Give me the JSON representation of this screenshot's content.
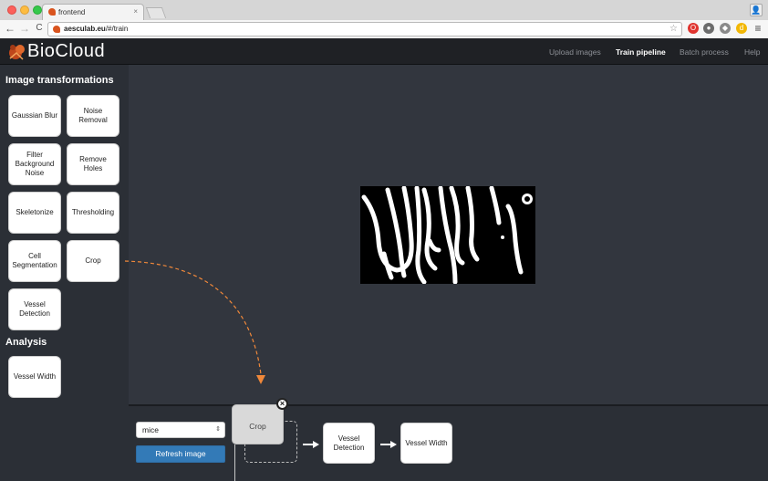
{
  "browser": {
    "tab_title": "frontend",
    "tab_close": "×",
    "url_domain": "aesculab.eu",
    "url_path": "/#/train",
    "back_glyph": "←",
    "forward_glyph": "→",
    "reload_glyph": "C",
    "star_glyph": "☆",
    "menu_glyph": "≡",
    "profile_glyph": "👤",
    "extension_icons": [
      "opera-icon",
      "ghostery-icon",
      "extension-icon",
      "lastpass-icon"
    ]
  },
  "app": {
    "logo_text": "BioCloud",
    "nav": [
      {
        "label": "Upload images",
        "active": false
      },
      {
        "label": "Train pipeline",
        "active": true
      },
      {
        "label": "Batch process",
        "active": false
      },
      {
        "label": "Help",
        "active": false
      }
    ]
  },
  "sidebar": {
    "transformations_title": "Image transformations",
    "transformations": [
      "Gaussian Blur",
      "Noise Removal",
      "Filter Background Noise",
      "Remove Holes",
      "Skeletonize",
      "Thresholding",
      "Cell Segmentation",
      "Crop",
      "Vessel Detection"
    ],
    "analysis_title": "Analysis",
    "analysis": [
      "Vessel Width"
    ]
  },
  "pipeline": {
    "dataset_select": "mice",
    "select_arrow": "⇕",
    "refresh_label": "Refresh image",
    "dragging_item": "Crop",
    "remove_glyph": "×",
    "steps": [
      "Vessel Detection",
      "Vessel Width"
    ]
  },
  "colors": {
    "accent_orange": "#f0883a",
    "button_blue": "#337ab7",
    "navbar_bg": "#1f2125",
    "canvas_bg": "#32363e"
  }
}
